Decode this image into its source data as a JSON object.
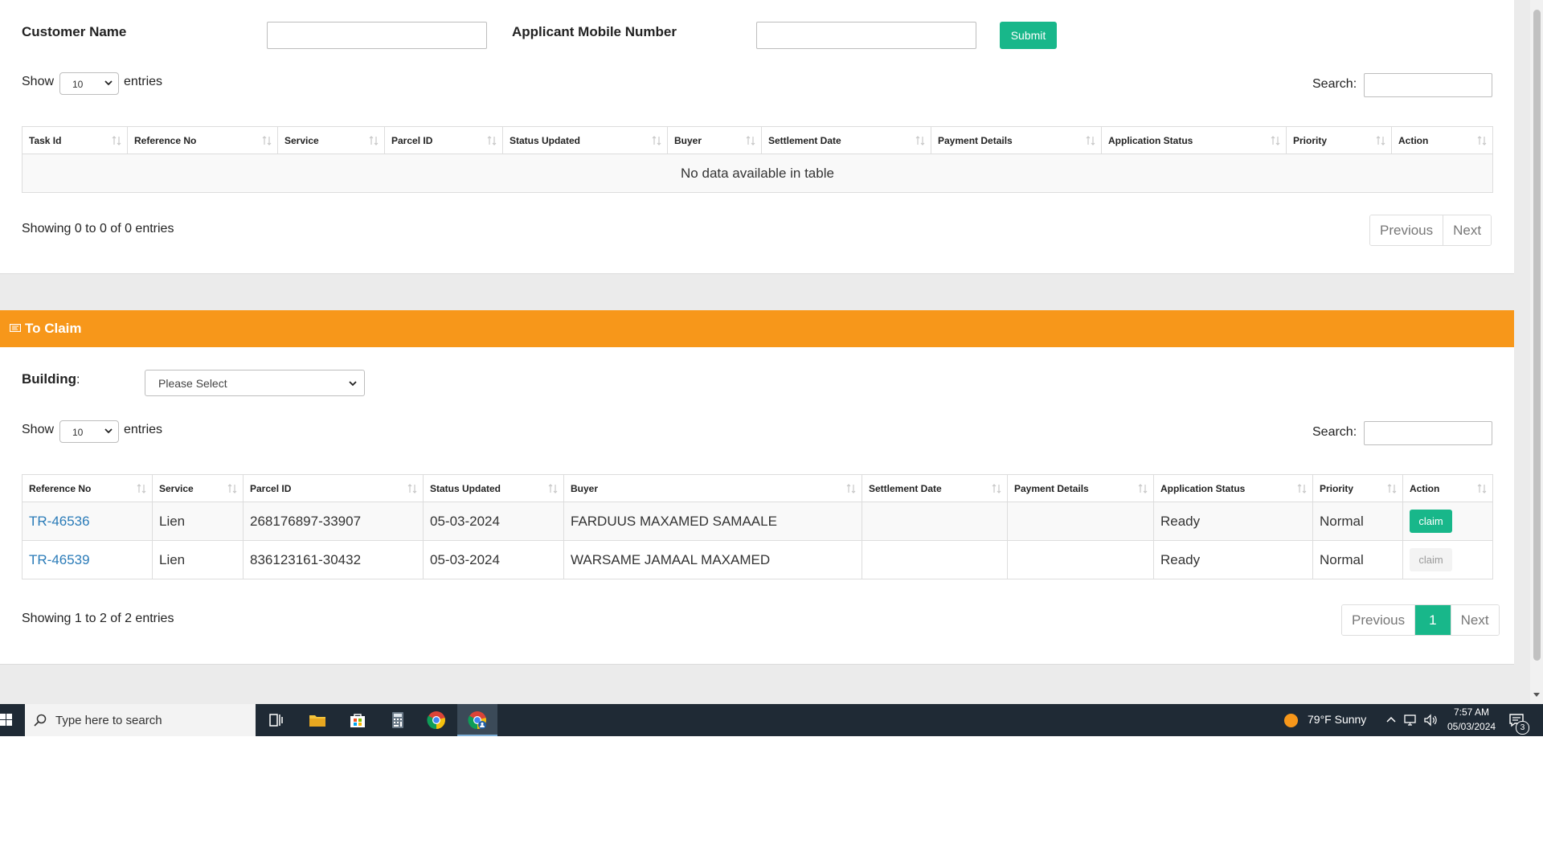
{
  "search_form": {
    "customer_label": "Customer Name",
    "customer_value": "",
    "mobile_label": "Applicant Mobile Number",
    "mobile_value": "",
    "submit_label": "Submit"
  },
  "table1": {
    "show_label": "Show",
    "entries_label": "entries",
    "length_value": "10",
    "search_label": "Search:",
    "search_value": "",
    "columns": [
      "Task Id",
      "Reference No",
      "Service",
      "Parcel ID",
      "Status Updated",
      "Buyer",
      "Settlement Date",
      "Payment Details",
      "Application Status",
      "Priority",
      "Action"
    ],
    "empty_message": "No data available in table",
    "info": "Showing 0 to 0 of 0 entries",
    "pagination": {
      "previous": "Previous",
      "next": "Next"
    }
  },
  "to_claim": {
    "title": "To Claim",
    "building_label": "Building",
    "building_colon": ":",
    "building_value": "Please Select",
    "show_label": "Show",
    "entries_label": "entries",
    "length_value": "10",
    "search_label": "Search:",
    "search_value": "",
    "columns": [
      "Reference No",
      "Service",
      "Parcel ID",
      "Status Updated",
      "Buyer",
      "Settlement Date",
      "Payment Details",
      "Application Status",
      "Priority",
      "Action"
    ],
    "rows": [
      {
        "reference_no": "TR-46536",
        "service": "Lien",
        "parcel_id": "268176897-33907",
        "status_updated": "05-03-2024",
        "buyer": "FARDUUS MAXAMED SAMAALE",
        "settlement_date": "",
        "payment_details": "",
        "application_status": "Ready",
        "priority": "Normal",
        "action": "claim"
      },
      {
        "reference_no": "TR-46539",
        "service": "Lien",
        "parcel_id": "836123161-30432",
        "status_updated": "05-03-2024",
        "buyer": "WARSAME JAMAAL MAXAMED",
        "settlement_date": "",
        "payment_details": "",
        "application_status": "Ready",
        "priority": "Normal",
        "action": "claim"
      }
    ],
    "info": "Showing 1 to 2 of 2 entries",
    "pagination": {
      "previous": "Previous",
      "current": "1",
      "next": "Next"
    }
  },
  "taskbar": {
    "search_placeholder": "Type here to search",
    "weather": "79°F  Sunny",
    "time": "7:57 AM",
    "date": "05/03/2024",
    "notification_count": "3"
  },
  "colors": {
    "accent_green": "#18b78a",
    "claim_header": "#f7971a",
    "link": "#2a7bb8",
    "taskbar": "#1f2a35"
  }
}
